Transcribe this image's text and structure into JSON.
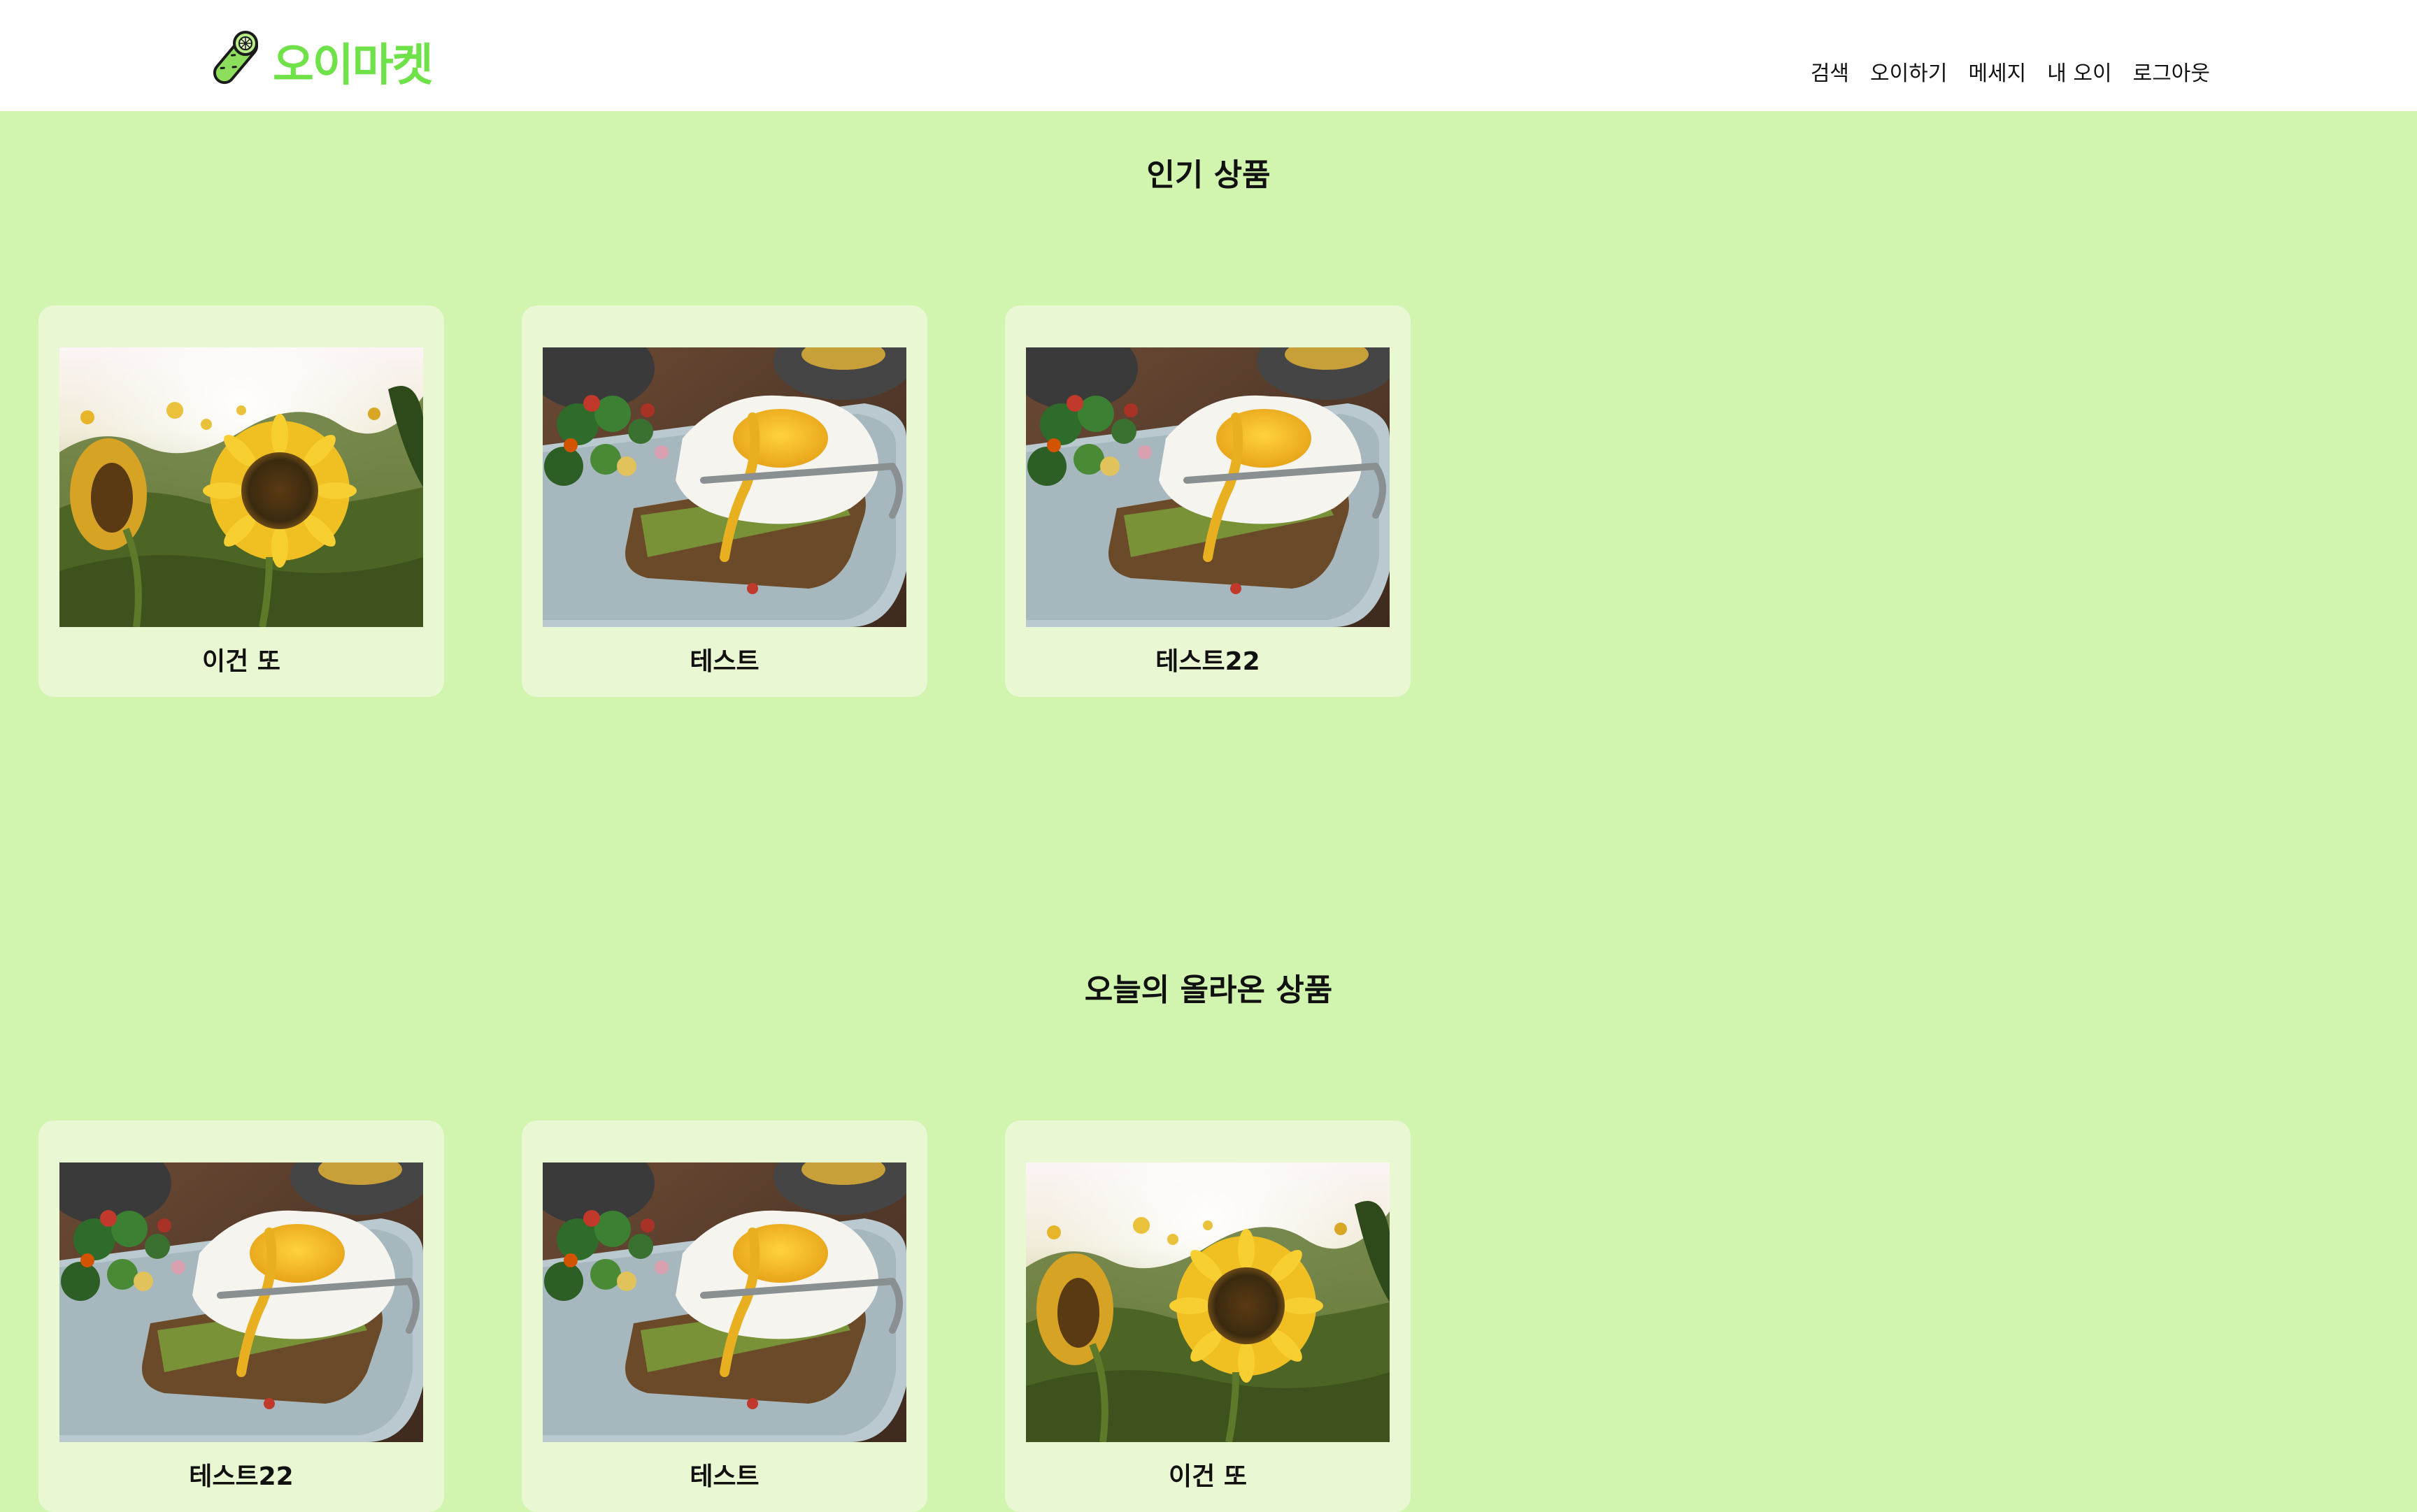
{
  "header": {
    "logo_text": "오이마켓",
    "nav": [
      {
        "label": "검색"
      },
      {
        "label": "오이하기"
      },
      {
        "label": "메세지"
      },
      {
        "label": "내 오이"
      },
      {
        "label": "로그아웃"
      }
    ]
  },
  "popular": {
    "title": "인기 상품",
    "items": [
      {
        "title": "이건 또",
        "image": "sunflower-photo"
      },
      {
        "title": "테스트",
        "image": "egg-toast-photo"
      },
      {
        "title": "테스트22",
        "image": "egg-toast-photo"
      }
    ]
  },
  "today": {
    "title": "오늘의 올라온 상품",
    "items": [
      {
        "title": "테스트22",
        "image": "egg-toast-photo"
      },
      {
        "title": "테스트",
        "image": "egg-toast-photo"
      },
      {
        "title": "이건 또",
        "image": "sunflower-photo"
      }
    ]
  },
  "colors": {
    "page_background": "#d1f5af",
    "header_background": "#ffffff",
    "card_background": "#e9f7d3",
    "brand_green": "#6fe24a"
  }
}
